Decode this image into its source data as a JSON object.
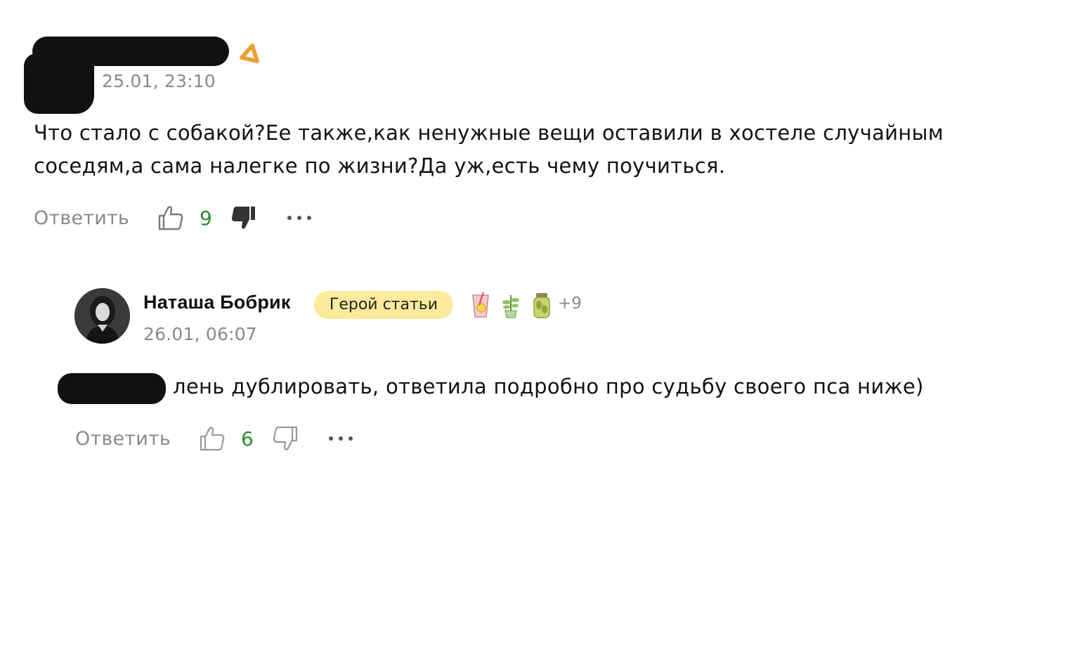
{
  "comment1": {
    "date": "25.01, 23:10",
    "text": "Что стало с собакой?Ее также,как ненужные вещи оставили в хостеле случайным соседям,а сама налегке по жизни?Да уж,есть чему поучиться.",
    "reply_label": "Ответить",
    "likes": "9",
    "icons": {
      "badge": "triangle-badge-icon",
      "like": "thumbs-up-icon",
      "dislike": "thumbs-down-filled-icon",
      "more": "more-dots-icon"
    }
  },
  "comment2": {
    "author": "Наташа Бобрик",
    "badge": "Герой статьи",
    "awards_more": "+9",
    "date": "26.01, 06:07",
    "text": "лень дублировать, ответила подробно про судьбу своего пса ниже)",
    "reply_label": "Ответить",
    "likes": "6",
    "icons": {
      "avatar": "user-avatar",
      "awards": [
        "drink-glass-icon",
        "plant-icon",
        "jar-icon"
      ],
      "like": "thumbs-up-icon",
      "dislike": "thumbs-down-icon",
      "more": "more-dots-icon"
    }
  },
  "colors": {
    "like_count": "#2c8a2c",
    "muted_text": "#8a8a8a",
    "hero_badge_bg": "#fbeb9b",
    "badge_orange": "#f0a43a"
  }
}
